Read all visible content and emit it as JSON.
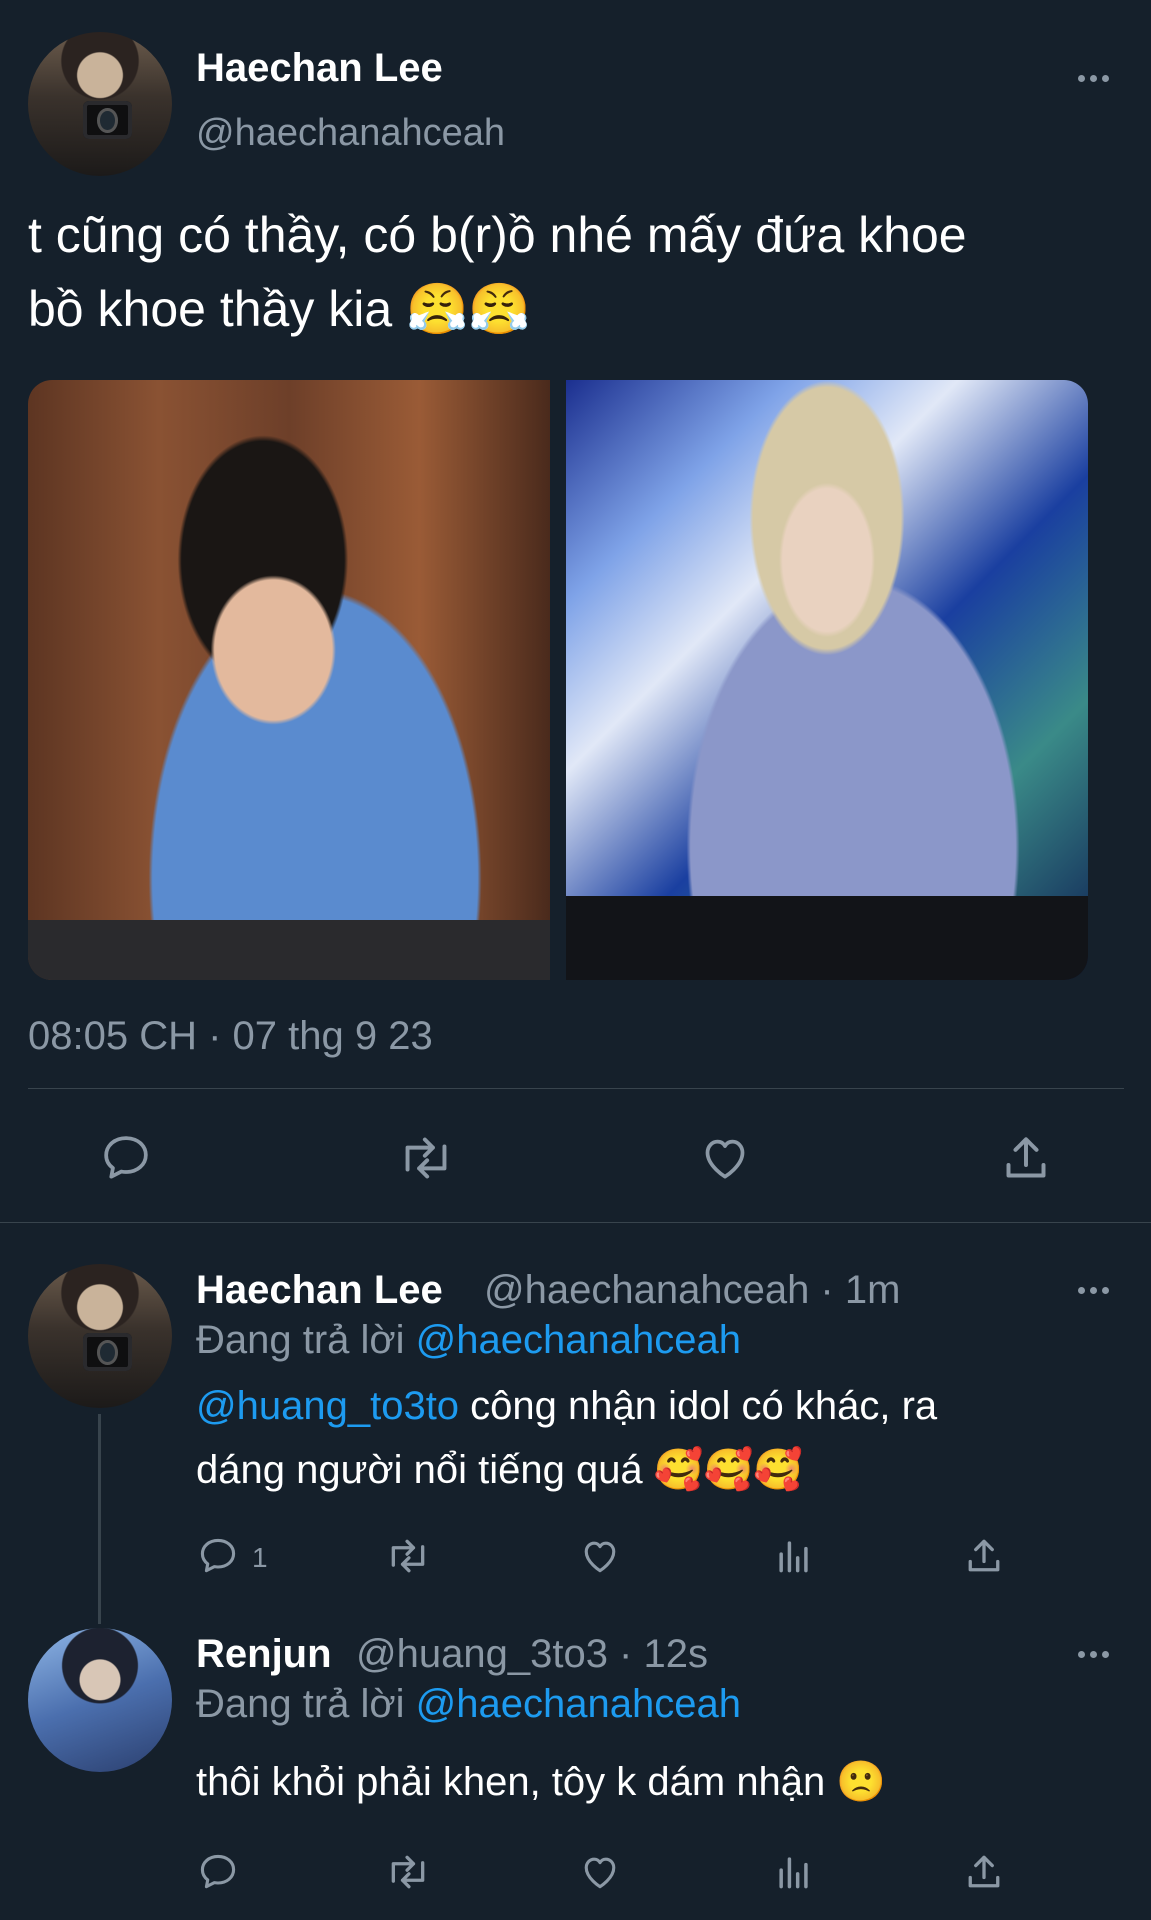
{
  "main_tweet": {
    "author_name": "Haechan Lee",
    "author_handle": "@haechanahceah",
    "text_line1": "t cũng có thầy, có b(r)ồ nhé mấy đứa khoe",
    "text_line2": "bồ khoe thầy kia 😤😤",
    "timestamp": "08:05 CH · 07 thg 9 23",
    "avatar_icon": "avatar-camera-selfie",
    "photos": [
      "photo-person-blue-sweater",
      "photo-person-striped-shirt-glasses"
    ],
    "actions": [
      "reply-icon",
      "retweet-icon",
      "like-icon",
      "share-icon"
    ]
  },
  "replies": [
    {
      "author_name": "Haechan Lee",
      "meta": "@haechanahceah · 1m",
      "replying_prefix": "Đang trả lời",
      "replying_to": "@haechanahceah",
      "mention": "@huang_to3to",
      "text_line1_rest": " công nhận idol có khác, ra",
      "text_line2": "dáng người nổi tiếng quá 🥰🥰🥰",
      "reply_count": "1"
    },
    {
      "author_name": "Renjun",
      "meta": "@huang_3to3 · 12s",
      "replying_prefix": "Đang trả lời",
      "replying_to": "@haechanahceah",
      "text_line1": "thôi khỏi phải khen, tôy k dám nhận 🙁"
    }
  ],
  "colors": {
    "background": "#15202b",
    "text": "#ffffff",
    "muted": "#8b98a5",
    "accent": "#1d9bf0",
    "divider": "#38444d"
  }
}
